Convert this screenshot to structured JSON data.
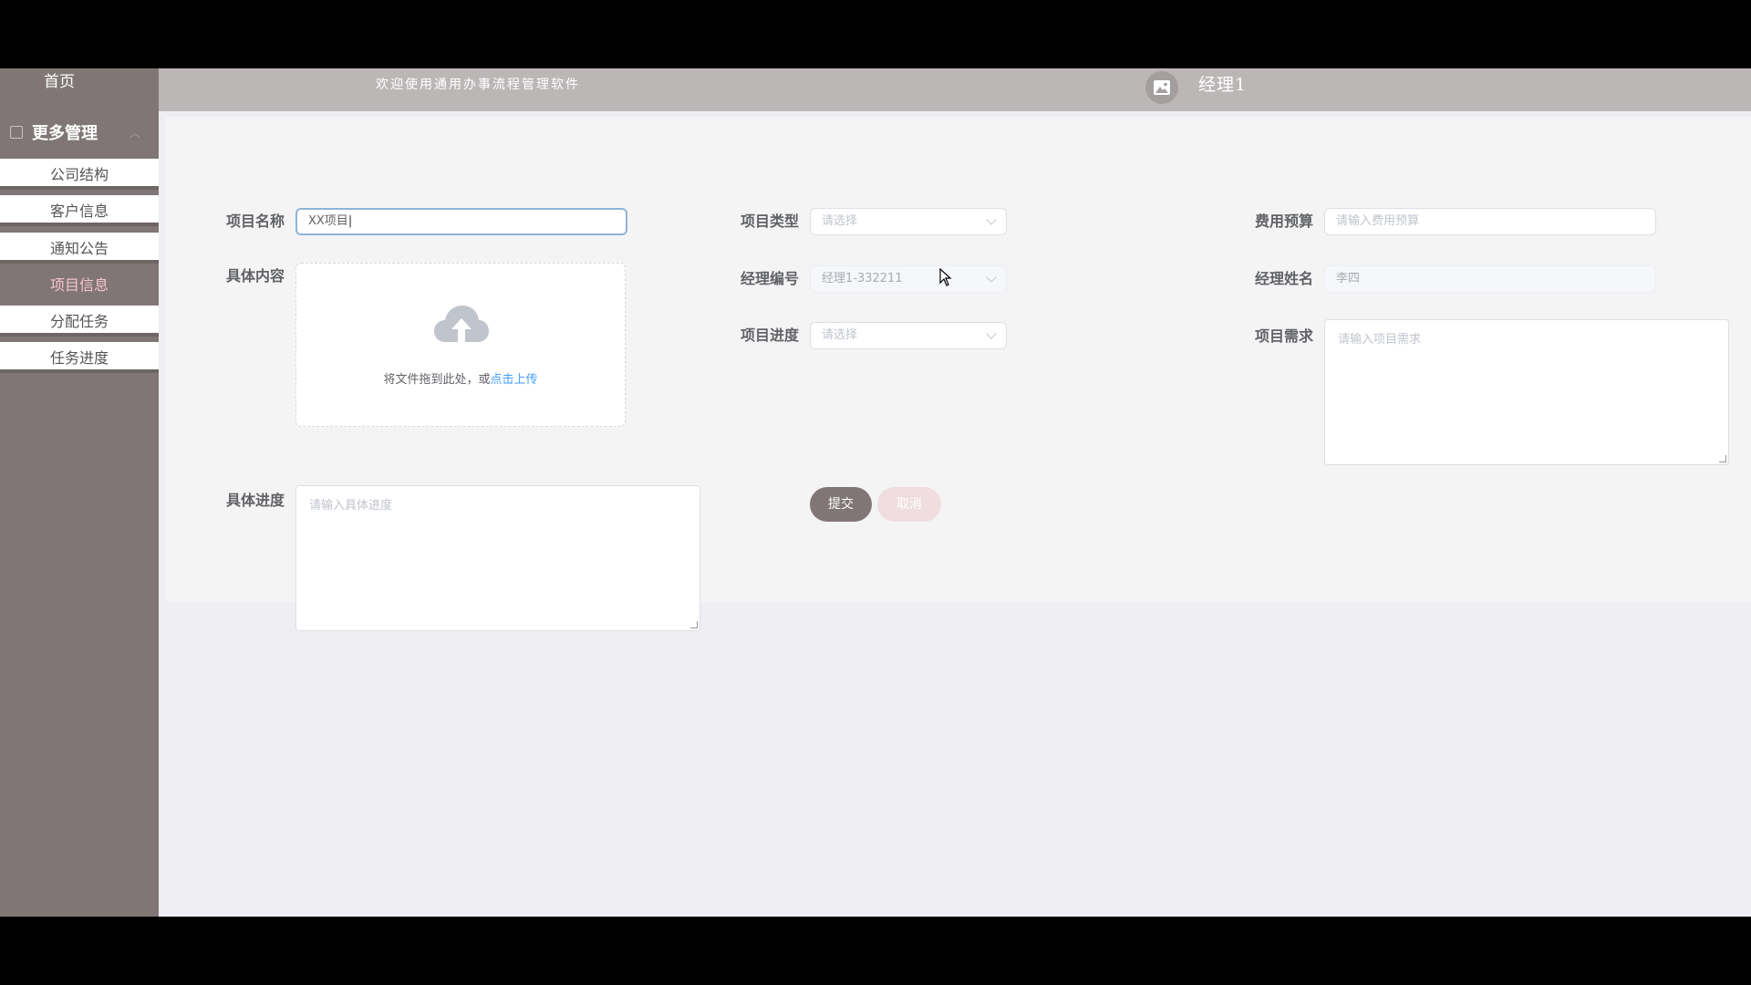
{
  "sidebar": {
    "home": "首页",
    "group_label": "更多管理",
    "items": [
      {
        "label": "公司结构"
      },
      {
        "label": "客户信息"
      },
      {
        "label": "通知公告"
      },
      {
        "label": "项目信息",
        "active": true
      },
      {
        "label": "分配任务"
      },
      {
        "label": "任务进度"
      }
    ]
  },
  "header": {
    "welcome": "欢迎使用通用办事流程管理软件",
    "username": "经理1",
    "avatar_icon": "image-icon"
  },
  "form": {
    "project_name": {
      "label": "项目名称",
      "value": "XX项目"
    },
    "content": {
      "label": "具体内容",
      "upload_text": "将文件拖到此处，或",
      "upload_link": "点击上传"
    },
    "project_type": {
      "label": "项目类型",
      "placeholder": "请选择"
    },
    "manager_no": {
      "label": "经理编号",
      "value": "经理1-332211"
    },
    "project_progress": {
      "label": "项目进度",
      "placeholder": "请选择"
    },
    "budget": {
      "label": "费用预算",
      "placeholder": "请输入费用预算"
    },
    "manager_name": {
      "label": "经理姓名",
      "value": "李四"
    },
    "requirement": {
      "label": "项目需求",
      "placeholder": "请输入项目需求"
    },
    "detail_progress": {
      "label": "具体进度",
      "placeholder": "请输入具体进度"
    },
    "submit_label": "提交",
    "cancel_label": "取消"
  },
  "colors": {
    "sidebar_bg": "#817676",
    "header_bg": "#bcb7b7",
    "active_text": "#f7c4cc",
    "link": "#409eff"
  }
}
